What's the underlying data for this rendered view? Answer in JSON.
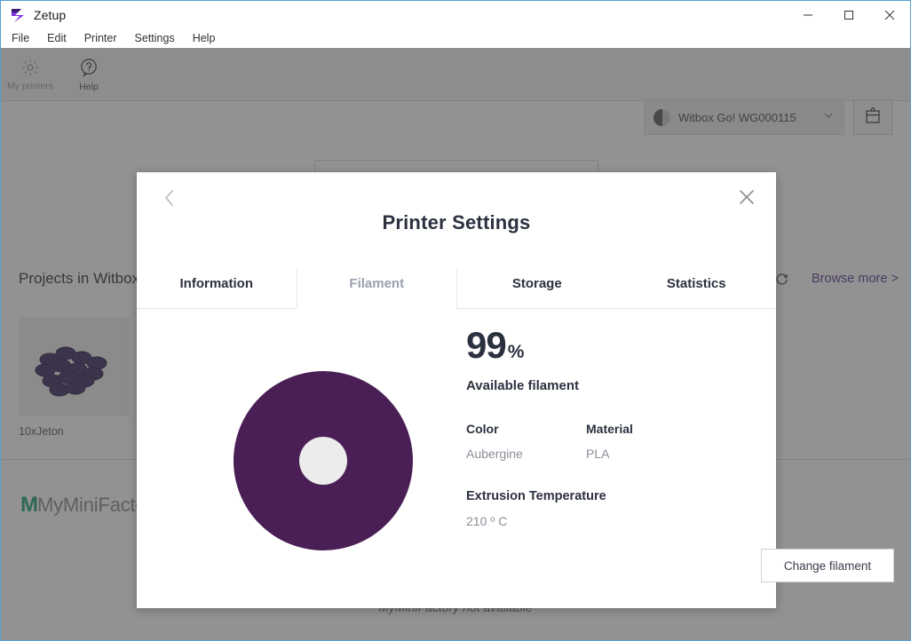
{
  "window": {
    "title": "Zetup",
    "logo_icon": "zetup-logo-icon",
    "minimize_label": "–",
    "maximize_label": "□",
    "close_label": "✕"
  },
  "menu": {
    "items": [
      {
        "label": "File"
      },
      {
        "label": "Edit"
      },
      {
        "label": "Printer"
      },
      {
        "label": "Settings"
      },
      {
        "label": "Help"
      }
    ]
  },
  "toolbar": {
    "buttons": [
      {
        "label": "My printers",
        "icon": "gear-icon"
      },
      {
        "label": "Help",
        "icon": "question-bubble-icon"
      }
    ],
    "printer_select": {
      "name": "Witbox Go! WG000115",
      "status_icon": "half-filled-circle-icon",
      "chevron_icon": "chevron-down-icon"
    },
    "printer_box_button": {
      "icon": "printer-box-icon"
    }
  },
  "background": {
    "search_placeholder": "",
    "projects_title": "Projects in Witbox",
    "refresh_icon": "refresh-icon",
    "browse_more": "Browse more >",
    "project": {
      "name": "10xJeton"
    },
    "mmf_mark": "M",
    "mmf_word": "MyMiniFactory",
    "mmf_unavailable": "MyMiniFactory not available"
  },
  "modal": {
    "title": "Printer Settings",
    "back_icon": "chevron-left-icon",
    "close_icon": "close-icon",
    "tabs": [
      {
        "label": "Information",
        "active": false
      },
      {
        "label": "Filament",
        "active": true
      },
      {
        "label": "Storage",
        "active": false
      },
      {
        "label": "Statistics",
        "active": false
      }
    ],
    "filament": {
      "spool_icon": "filament-spool-icon",
      "spool_color": "#4a1f56",
      "spool_hub_color": "#ececec",
      "percent_value": "99",
      "percent_unit": "%",
      "percent_caption": "Available filament",
      "color_label": "Color",
      "color_value": "Aubergine",
      "material_label": "Material",
      "material_value": "PLA",
      "temperature_label": "Extrusion Temperature",
      "temperature_value": "210 º C",
      "change_filament_label": "Change filament"
    }
  },
  "colors": {
    "accent_purple": "#5b3a8e",
    "spool_purple": "#4a1f56",
    "mmf_green": "#1f9e7a",
    "title_dark": "#2c3140",
    "muted_text": "#8b8f99"
  }
}
